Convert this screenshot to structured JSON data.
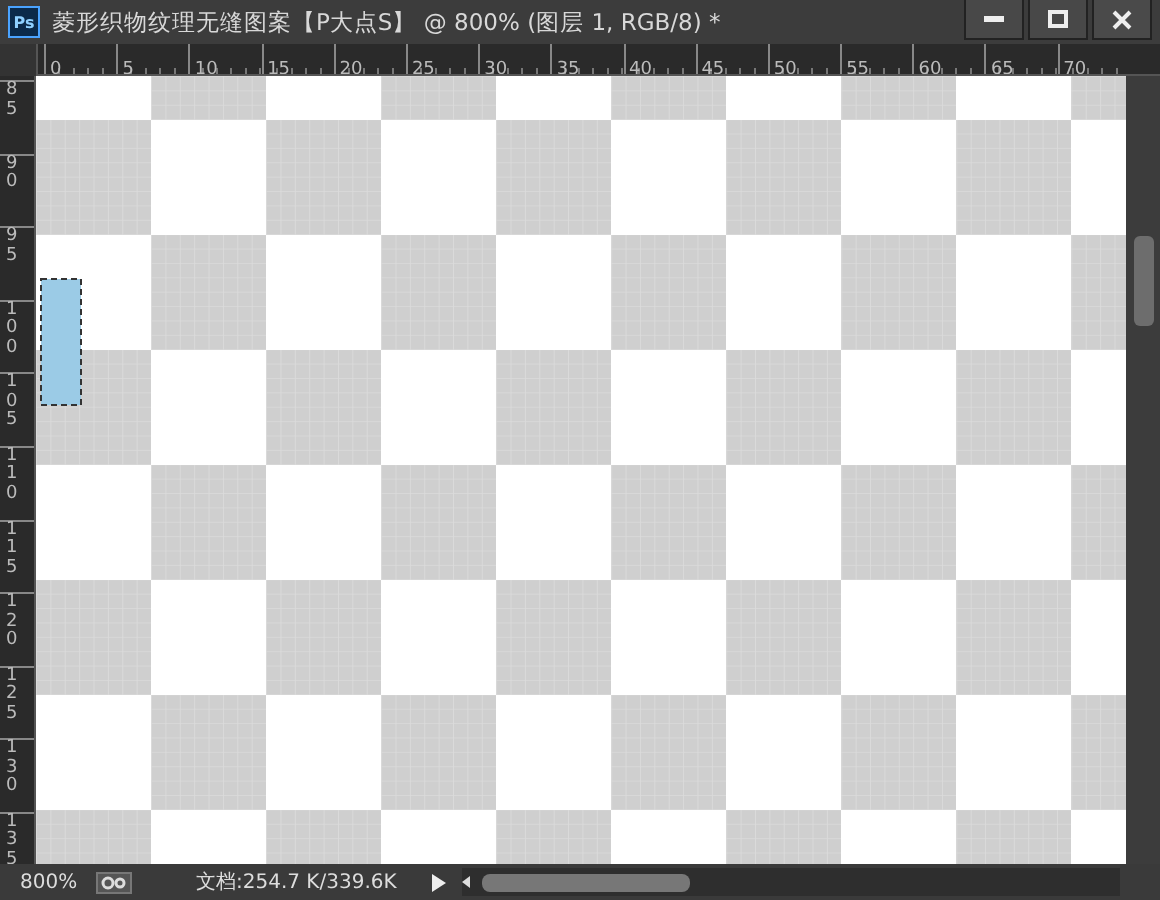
{
  "window": {
    "app_badge": "Ps",
    "title": "菱形织物纹理无缝图案【P大点S】 @ 800% (图层 1, RGB/8) *"
  },
  "rulers": {
    "horizontal": [
      "0",
      "5",
      "10",
      "15",
      "20",
      "25",
      "30",
      "35",
      "40",
      "45",
      "50",
      "55",
      "60",
      "65",
      "70"
    ],
    "vertical": [
      "85",
      "90",
      "95",
      "100",
      "105",
      "110",
      "115",
      "120",
      "125",
      "130",
      "135"
    ]
  },
  "status_bar": {
    "zoom": "800%",
    "document_info": "文档:254.7 K/339.6K"
  }
}
